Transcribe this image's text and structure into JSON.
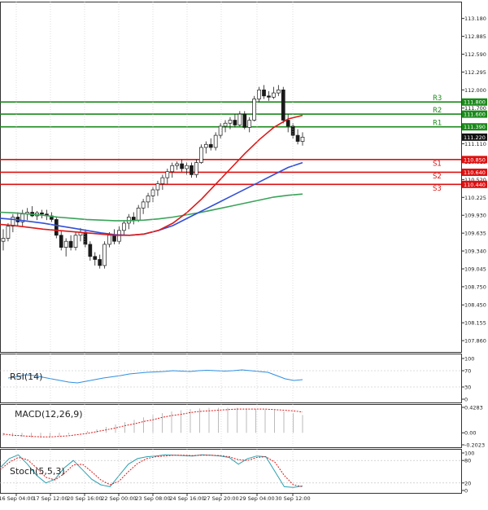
{
  "chart_data": [
    {
      "type": "candlestick",
      "title": "",
      "ylim": [
        107.7,
        113.35
      ],
      "y_ticks": [
        "113.180",
        "112.885",
        "112.590",
        "112.295",
        "112.000",
        "111.700",
        "111.405",
        "111.110",
        "110.815",
        "110.520",
        "110.225",
        "109.930",
        "109.635",
        "109.340",
        "109.045",
        "108.750",
        "108.450",
        "108.155",
        "107.860"
      ],
      "x_ticks": [
        "16 Sep 04:00",
        "17 Sep 12:00",
        "20 Sep 16:00",
        "22 Sep 00:00",
        "23 Sep 08:00",
        "24 Sep 16:00",
        "27 Sep 20:00",
        "29 Sep 04:00",
        "30 Sep 12:00"
      ],
      "current_price": {
        "label": "111.220",
        "value": 111.22,
        "color": "#111111"
      },
      "levels": [
        {
          "name": "R3",
          "value": 111.8,
          "label": "111.800",
          "color": "#1a8a1a"
        },
        {
          "name": "R2",
          "value": 111.6,
          "label": "111.600",
          "color": "#1a8a1a"
        },
        {
          "name": "R1",
          "value": 111.39,
          "label": "111.390",
          "color": "#1a8a1a"
        },
        {
          "name": "S1",
          "value": 110.85,
          "label": "110.850",
          "color": "#dd1111"
        },
        {
          "name": "S2",
          "value": 110.64,
          "label": "110.640",
          "color": "#dd1111"
        },
        {
          "name": "S3",
          "value": 110.44,
          "label": "110.440",
          "color": "#dd1111"
        }
      ],
      "candles": [
        [
          109.5,
          109.7,
          109.35,
          109.55
        ],
        [
          109.55,
          109.8,
          109.5,
          109.75
        ],
        [
          109.75,
          109.95,
          109.65,
          109.9
        ],
        [
          109.9,
          109.98,
          109.75,
          109.82
        ],
        [
          109.82,
          110.02,
          109.75,
          109.95
        ],
        [
          109.95,
          110.05,
          109.85,
          109.98
        ],
        [
          109.98,
          110.08,
          109.9,
          109.92
        ],
        [
          109.92,
          110.0,
          109.85,
          109.97
        ],
        [
          109.97,
          110.02,
          109.88,
          109.95
        ],
        [
          109.95,
          110.02,
          109.85,
          109.92
        ],
        [
          109.92,
          109.98,
          109.82,
          109.86
        ],
        [
          109.86,
          109.9,
          109.55,
          109.6
        ],
        [
          109.6,
          109.68,
          109.35,
          109.4
        ],
        [
          109.4,
          109.55,
          109.25,
          109.5
        ],
        [
          109.5,
          109.6,
          109.35,
          109.4
        ],
        [
          109.4,
          109.65,
          109.35,
          109.6
        ],
        [
          109.6,
          109.72,
          109.5,
          109.65
        ],
        [
          109.65,
          109.7,
          109.4,
          109.45
        ],
        [
          109.45,
          109.5,
          109.18,
          109.25
        ],
        [
          109.25,
          109.32,
          109.1,
          109.2
        ],
        [
          109.2,
          109.28,
          109.05,
          109.1
        ],
        [
          109.1,
          109.5,
          109.05,
          109.45
        ],
        [
          109.45,
          109.65,
          109.4,
          109.6
        ],
        [
          109.6,
          109.7,
          109.45,
          109.5
        ],
        [
          109.5,
          109.75,
          109.45,
          109.68
        ],
        [
          109.68,
          109.85,
          109.6,
          109.8
        ],
        [
          109.8,
          109.95,
          109.7,
          109.9
        ],
        [
          109.9,
          109.98,
          109.78,
          109.85
        ],
        [
          109.85,
          110.1,
          109.82,
          110.05
        ],
        [
          110.05,
          110.2,
          109.95,
          110.15
        ],
        [
          110.15,
          110.3,
          110.05,
          110.25
        ],
        [
          110.25,
          110.4,
          110.15,
          110.35
        ],
        [
          110.35,
          110.5,
          110.25,
          110.45
        ],
        [
          110.45,
          110.6,
          110.35,
          110.55
        ],
        [
          110.55,
          110.7,
          110.45,
          110.65
        ],
        [
          110.65,
          110.8,
          110.55,
          110.75
        ],
        [
          110.75,
          110.82,
          110.68,
          110.78
        ],
        [
          110.78,
          110.85,
          110.65,
          110.7
        ],
        [
          110.7,
          110.8,
          110.6,
          110.75
        ],
        [
          110.75,
          110.8,
          110.55,
          110.6
        ],
        [
          110.6,
          110.85,
          110.55,
          110.8
        ],
        [
          110.8,
          111.1,
          110.78,
          111.05
        ],
        [
          111.05,
          111.15,
          110.95,
          111.1
        ],
        [
          111.1,
          111.2,
          111.0,
          111.05
        ],
        [
          111.05,
          111.3,
          111.0,
          111.25
        ],
        [
          111.25,
          111.45,
          111.2,
          111.4
        ],
        [
          111.4,
          111.5,
          111.3,
          111.45
        ],
        [
          111.45,
          111.55,
          111.35,
          111.5
        ],
        [
          111.5,
          111.6,
          111.38,
          111.42
        ],
        [
          111.42,
          111.65,
          111.4,
          111.6
        ],
        [
          111.6,
          111.65,
          111.35,
          111.38
        ],
        [
          111.38,
          111.55,
          111.3,
          111.5
        ],
        [
          111.5,
          111.9,
          111.48,
          111.85
        ],
        [
          111.85,
          112.05,
          111.8,
          112.0
        ],
        [
          112.0,
          112.08,
          111.85,
          111.9
        ],
        [
          111.9,
          111.98,
          111.82,
          111.88
        ],
        [
          111.88,
          112.05,
          111.85,
          111.95
        ],
        [
          111.95,
          112.08,
          111.9,
          112.0
        ],
        [
          112.0,
          112.05,
          111.45,
          111.5
        ],
        [
          111.5,
          111.6,
          111.3,
          111.4
        ],
        [
          111.4,
          111.45,
          111.2,
          111.25
        ],
        [
          111.25,
          111.35,
          111.1,
          111.15
        ],
        [
          111.15,
          111.3,
          111.08,
          111.22
        ]
      ],
      "sma_red": [
        109.78,
        109.76,
        109.73,
        109.7,
        109.68,
        109.66,
        109.64,
        109.62,
        109.6,
        109.6,
        109.62,
        109.68,
        109.8,
        109.98,
        110.2,
        110.45,
        110.7,
        110.95,
        111.18,
        111.38,
        111.52,
        111.58
      ],
      "sma_blue": [
        109.88,
        109.86,
        109.83,
        109.8,
        109.76,
        109.72,
        109.68,
        109.64,
        109.61,
        109.6,
        109.62,
        109.68,
        109.76,
        109.88,
        110.0,
        110.12,
        110.24,
        110.36,
        110.48,
        110.6,
        110.72,
        110.8
      ],
      "sma_green": [
        109.98,
        109.97,
        109.95,
        109.93,
        109.9,
        109.88,
        109.86,
        109.85,
        109.84,
        109.84,
        109.85,
        109.87,
        109.9,
        109.94,
        109.98,
        110.03,
        110.08,
        110.13,
        110.18,
        110.23,
        110.26,
        110.28
      ]
    },
    {
      "type": "line",
      "name": "RSI(14)",
      "ylim": [
        0,
        100
      ],
      "y_ticks": [
        "100",
        "70",
        "30",
        "0"
      ],
      "values": [
        52,
        55,
        60,
        58,
        54,
        50,
        46,
        42,
        40,
        44,
        48,
        52,
        55,
        58,
        62,
        64,
        66,
        67,
        68,
        70,
        69,
        68,
        70,
        71,
        70,
        69,
        70,
        72,
        70,
        68,
        66,
        58,
        50,
        46,
        48
      ]
    },
    {
      "type": "histogram",
      "name": "MACD(12,26,9)",
      "ylim": [
        -0.2023,
        0.4283
      ],
      "y_ticks": [
        "0.4283",
        "0.00",
        "-0.2023"
      ],
      "values": [
        -0.05,
        -0.06,
        -0.07,
        -0.08,
        -0.08,
        -0.07,
        -0.05,
        -0.03,
        0.0,
        0.03,
        0.06,
        0.1,
        0.14,
        0.18,
        0.22,
        0.26,
        0.3,
        0.33,
        0.36,
        0.38,
        0.4,
        0.41,
        0.42,
        0.42,
        0.42,
        0.42,
        0.41,
        0.4,
        0.39,
        0.38,
        0.36,
        0.33,
        0.3
      ],
      "signal": [
        -0.02,
        -0.04,
        -0.05,
        -0.06,
        -0.07,
        -0.07,
        -0.06,
        -0.05,
        -0.03,
        -0.01,
        0.02,
        0.05,
        0.08,
        0.12,
        0.15,
        0.19,
        0.22,
        0.26,
        0.29,
        0.31,
        0.34,
        0.36,
        0.37,
        0.38,
        0.39,
        0.4,
        0.4,
        0.4,
        0.4,
        0.39,
        0.38,
        0.37,
        0.35
      ]
    },
    {
      "type": "line",
      "name": "Stoch(5,5,3)",
      "ylim": [
        0,
        100
      ],
      "y_ticks": [
        "100",
        "80",
        "20",
        "0"
      ],
      "k": [
        60,
        85,
        95,
        70,
        40,
        20,
        30,
        60,
        80,
        55,
        30,
        15,
        10,
        40,
        70,
        85,
        90,
        92,
        95,
        94,
        93,
        92,
        95,
        94,
        92,
        88,
        70,
        85,
        92,
        90,
        50,
        10,
        8,
        12
      ],
      "d": [
        55,
        75,
        88,
        82,
        60,
        35,
        28,
        45,
        68,
        70,
        50,
        28,
        15,
        25,
        50,
        72,
        85,
        90,
        92,
        94,
        94,
        93,
        94,
        94,
        93,
        90,
        82,
        80,
        88,
        90,
        75,
        40,
        15,
        10
      ]
    }
  ]
}
